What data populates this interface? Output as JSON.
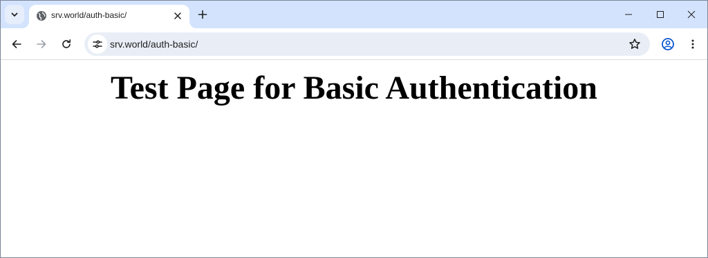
{
  "browser": {
    "tab": {
      "title": "srv.world/auth-basic/",
      "favicon": "globe-icon"
    },
    "address_bar": {
      "url": "srv.world/auth-basic/"
    },
    "colors": {
      "tabstrip": "#d3e3fd",
      "omnibox": "#e9eef6",
      "profile_accent": "#0b57d0"
    }
  },
  "page": {
    "heading": "Test Page for Basic Authentication"
  }
}
